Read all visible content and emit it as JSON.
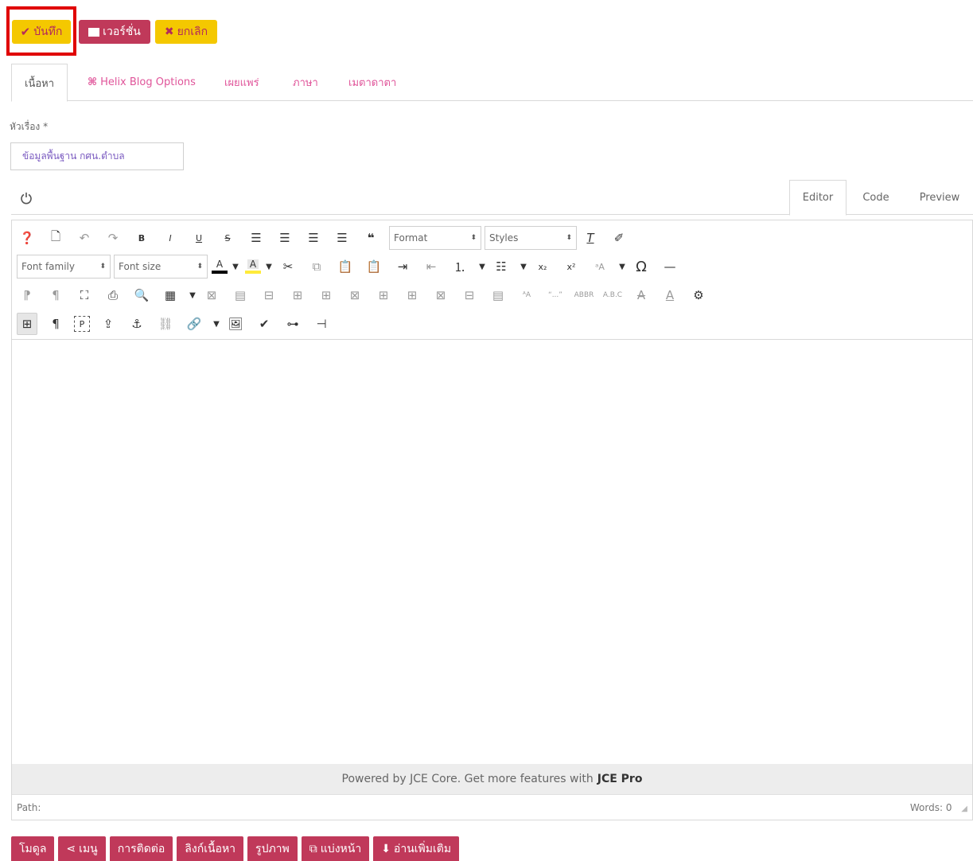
{
  "toolbar_top": {
    "save_label": "บันทึก",
    "version_label": "เวอร์ชั่น",
    "cancel_label": "ยกเลิก",
    "highlight_color": "#e00000"
  },
  "tabs": [
    {
      "label": "เนื้อหา",
      "active": true
    },
    {
      "label": "Helix Blog Options",
      "icon": "helix-icon"
    },
    {
      "label": "เผยแพร่"
    },
    {
      "label": "ภาษา"
    },
    {
      "label": "เมตาดาตา"
    }
  ],
  "title_field": {
    "label": "หัวเรื่อง *",
    "value": "ข้อมูลพื้นฐาน กศน.ตำบล"
  },
  "editor_modes": [
    "Editor",
    "Code",
    "Preview"
  ],
  "editor_toolbar": {
    "format_select": "Format",
    "styles_select": "Styles",
    "font_family_select": "Font family",
    "font_size_select": "Font size",
    "text_color": "#000000",
    "highlight_color": "#ffeb3b"
  },
  "editor": {
    "powered_text": "Powered by JCE Core. Get more features with",
    "powered_bold": "JCE Pro",
    "path_label": "Path:",
    "words_label": "Words: 0"
  },
  "bottom_buttons": [
    {
      "label": "โมดูล"
    },
    {
      "label": "เมนู",
      "icon": "share-icon"
    },
    {
      "label": "การติดต่อ"
    },
    {
      "label": "ลิงก์เนื้อหา"
    },
    {
      "label": "รูปภาพ"
    },
    {
      "label": "แบ่งหน้า",
      "icon": "copy-icon"
    },
    {
      "label": "อ่านเพิ่มเติม",
      "icon": "arrow-down-icon"
    }
  ],
  "colors": {
    "accent_yellow": "#f4c800",
    "accent_crimson": "#c0395a",
    "tab_pink": "#e0559a"
  }
}
